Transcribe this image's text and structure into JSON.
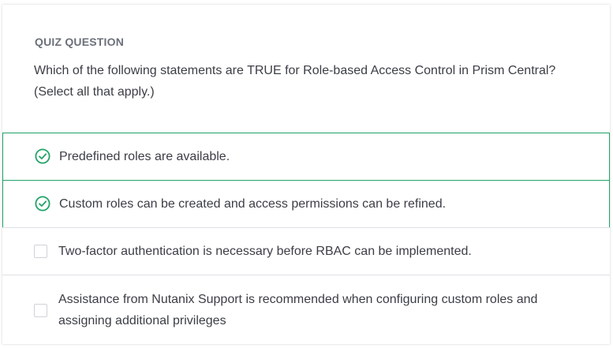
{
  "quiz": {
    "eyebrow": "QUIZ QUESTION",
    "question": "Which of the following statements are TRUE for Role-based Access Control in Prism Central? (Select all that apply.)",
    "options": [
      {
        "label": "Predefined roles are available.",
        "selected": true
      },
      {
        "label": "Custom roles can be created and access permissions can be refined.",
        "selected": true
      },
      {
        "label": "Two-factor authentication is necessary before RBAC can be implemented.",
        "selected": false
      },
      {
        "label": "Assistance from Nutanix Support is recommended when configuring custom roles and assigning additional privileges",
        "selected": false
      }
    ]
  },
  "colors": {
    "correct_accent": "#21a367",
    "text": "#3b3e45",
    "eyebrow": "#6c7079",
    "divider": "#dfe1e4"
  }
}
